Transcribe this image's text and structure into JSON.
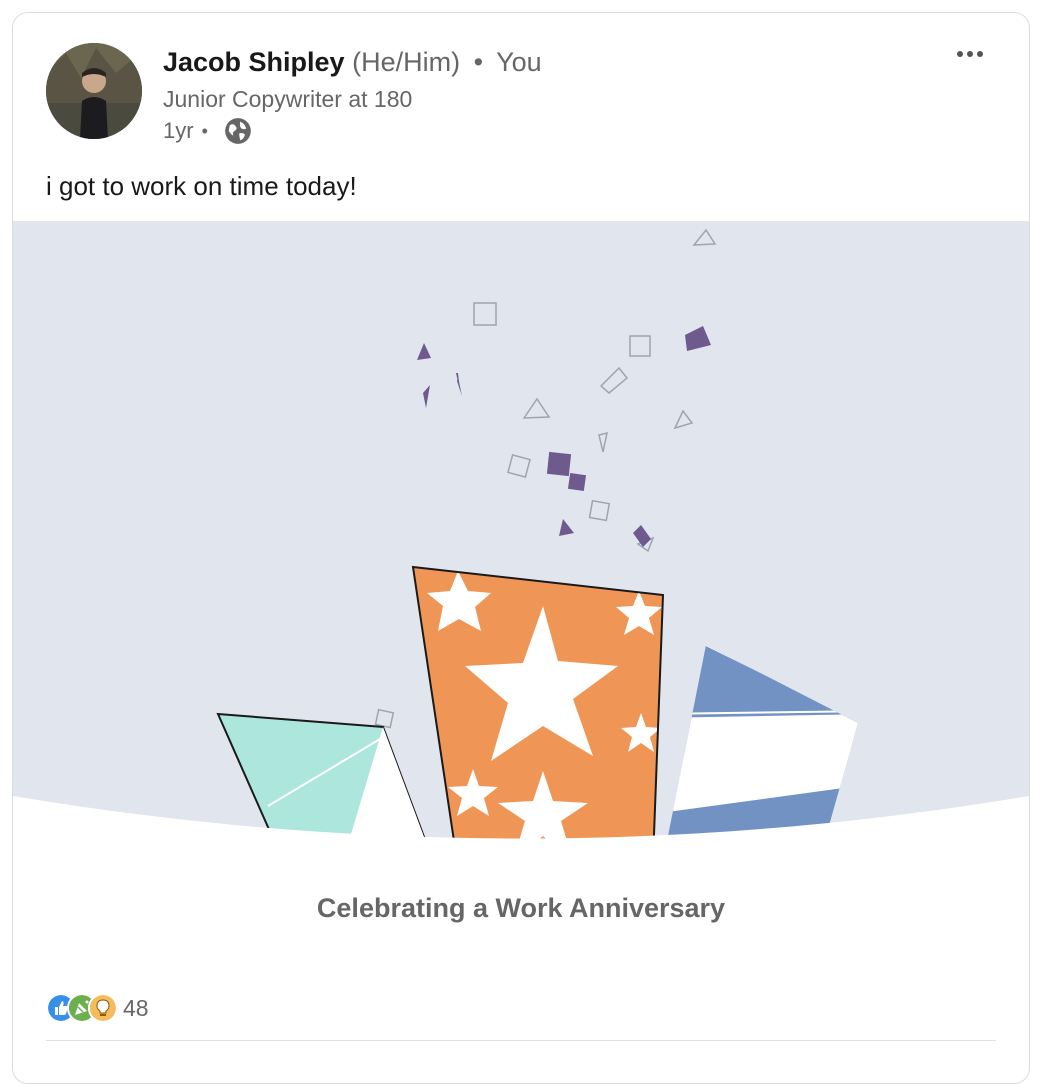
{
  "post": {
    "author_name": "Jacob Shipley",
    "pronouns": "(He/Him)",
    "separator": "•",
    "relation": "You",
    "headline": "Junior Copywriter at 180",
    "time_ago": "1yr",
    "time_dot": "•",
    "visibility_icon": "globe-icon",
    "text": "i got to work on time today!",
    "caption": "Celebrating a Work Anniversary",
    "reaction_count": "48",
    "reaction_icons": [
      "like-icon",
      "celebrate-icon",
      "insightful-icon"
    ]
  },
  "colors": {
    "media_bg": "#e1e5ee",
    "confetti": "#6e5a8c",
    "orange": "#ef9656",
    "teal": "#ace6dd",
    "blue": "#7292c3"
  }
}
